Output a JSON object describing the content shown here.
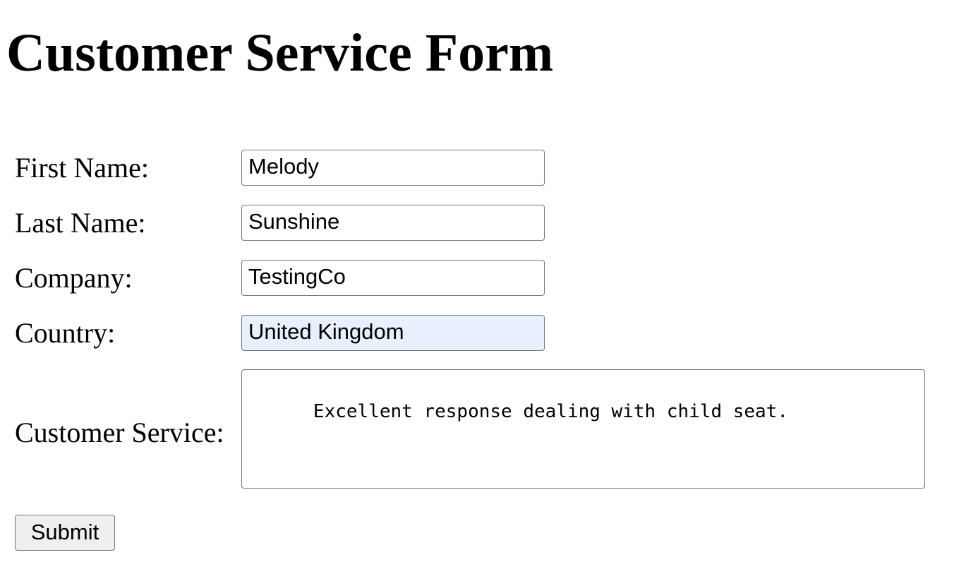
{
  "form": {
    "title": "Customer Service Form",
    "fields": {
      "first_name": {
        "label": "First Name:",
        "value": "Melody"
      },
      "last_name": {
        "label": "Last Name:",
        "value": "Sunshine"
      },
      "company": {
        "label": "Company:",
        "value": "TestingCo"
      },
      "country": {
        "label": "Country:",
        "value": "United Kingdom"
      },
      "customer_service": {
        "label": "Customer Service:",
        "value": "Excellent response dealing with child seat."
      }
    },
    "submit_label": "Submit"
  },
  "colors": {
    "autofill_background": "#e8f0fe",
    "button_background": "#efefef",
    "border": "#767676"
  },
  "icons": {
    "resize_handle": "resize-handle-icon"
  }
}
